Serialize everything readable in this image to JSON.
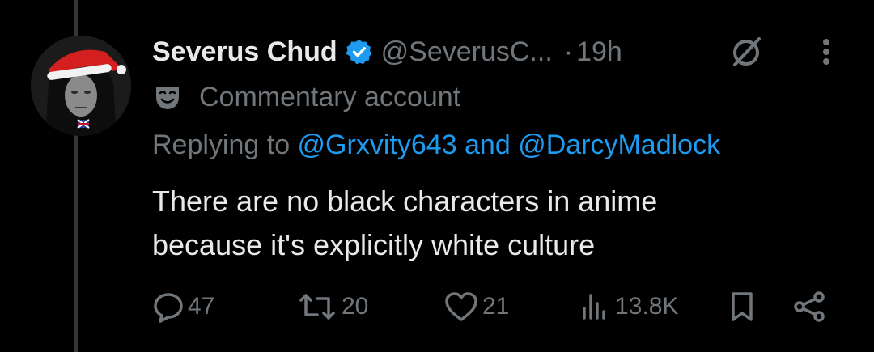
{
  "author": {
    "name": "Severus Chud",
    "handle": "@SeverusC...",
    "separator": "·",
    "time": "19h",
    "badge_label": "Commentary account"
  },
  "reply": {
    "prefix": "Replying to ",
    "mention1": "@Grxvity643",
    "joiner": " and ",
    "mention2": "@DarcyMadlock"
  },
  "text": {
    "line1": "There are no black characters in anime",
    "line2": "because it's explicitly white culture"
  },
  "actions": {
    "replies": "47",
    "reposts": "20",
    "likes": "21",
    "views": "13.8K"
  },
  "icons": [
    "verified-icon",
    "grok-icon",
    "more-icon",
    "mask-icon",
    "reply-icon",
    "repost-icon",
    "like-icon",
    "views-icon",
    "bookmark-icon",
    "share-icon"
  ],
  "colors": {
    "background": "#000000",
    "text": "#e7e9ea",
    "muted": "#71767b",
    "link": "#1d9bf0"
  }
}
